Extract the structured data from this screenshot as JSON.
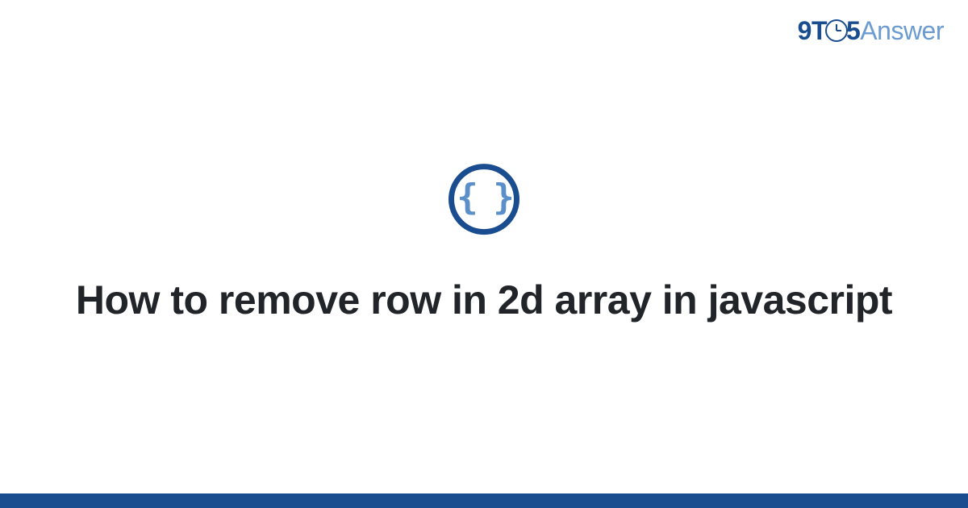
{
  "brand": {
    "part1": "9T",
    "part2": "5",
    "part3": "Answer"
  },
  "icon": {
    "name": "code-braces-icon",
    "glyph": "{ }"
  },
  "title": "How to remove row in 2d array in javascript",
  "colors": {
    "primary": "#1a4d8f",
    "secondary": "#5b8fc9",
    "text": "#212529"
  }
}
